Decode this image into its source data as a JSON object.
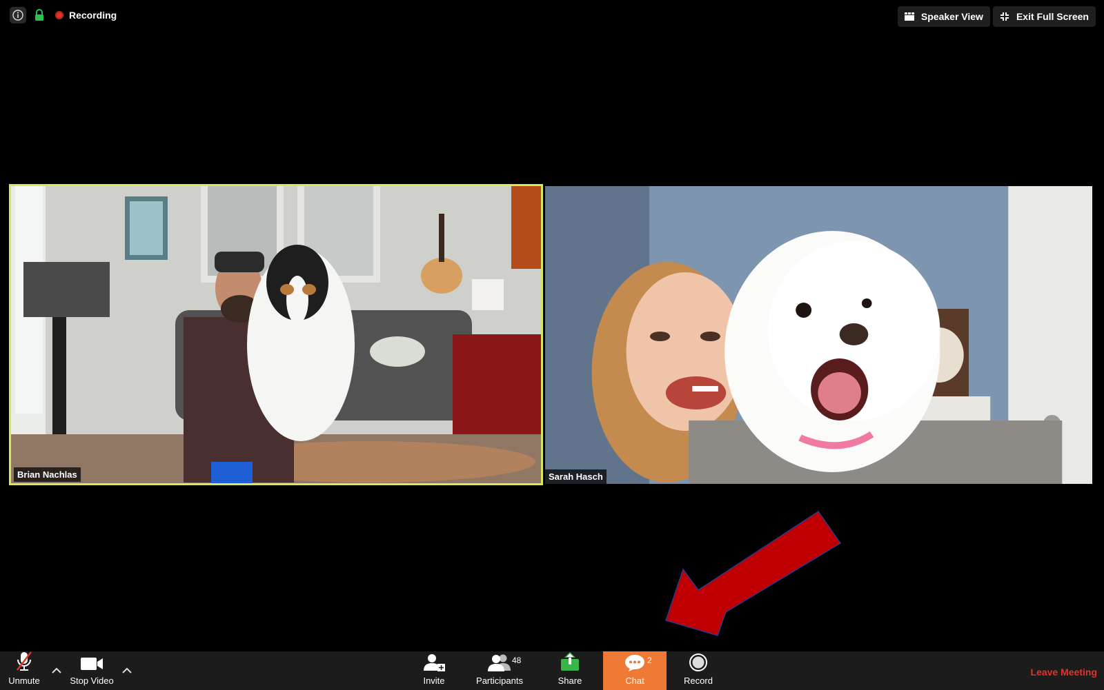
{
  "status": {
    "recording_label": "Recording"
  },
  "top_buttons": {
    "speaker_view": "Speaker View",
    "exit_full_screen": "Exit Full Screen"
  },
  "participants_tiles": [
    {
      "name": "Brian Nachlas",
      "active_speaker": true
    },
    {
      "name": "Sarah Hasch",
      "active_speaker": false
    }
  ],
  "toolbar": {
    "unmute": "Unmute",
    "stop_video": "Stop Video",
    "invite": "Invite",
    "participants": "Participants",
    "participants_count": "48",
    "share": "Share",
    "chat": "Chat",
    "chat_count": "2",
    "record": "Record",
    "leave_meeting": "Leave Meeting"
  },
  "colors": {
    "active_speaker_border": "#d7e85a",
    "chat_highlight": "#ef7a35",
    "leave_red": "#e0342b",
    "share_green": "#3ab54a",
    "annotation_arrow": "#c00000"
  }
}
